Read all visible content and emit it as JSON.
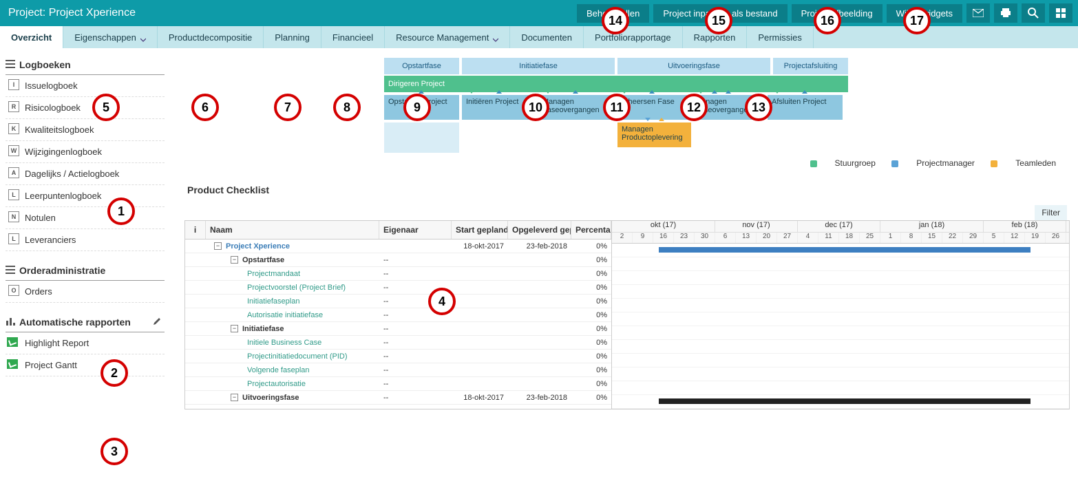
{
  "header": {
    "title": "Project: Project Xperience",
    "buttons": {
      "b14": "Beheer rollen",
      "b15": "Project inpakken als bestand",
      "b16": "Project afbeelding",
      "b17": "Wijzig widgets"
    }
  },
  "tabs": {
    "t0": "Overzicht",
    "t5": "Eigenschappen",
    "t6": "Productdecompositie",
    "t7": "Planning",
    "t8": "Financieel",
    "t9": "Resource Management",
    "t10": "Documenten",
    "t11": "Portfoliorapportage",
    "t12": "Rapporten",
    "t13": "Permissies"
  },
  "sidebar": {
    "sec1": "Logboeken",
    "items1": {
      "a": "Issuelogboek",
      "b": "Risicologboek",
      "c": "Kwaliteitslogboek",
      "d": "Wijzigingenlogboek",
      "e": "Dagelijks / Actielogboek",
      "f": "Leerpuntenlogboek",
      "g": "Notulen",
      "h": "Leveranciers"
    },
    "letters1": {
      "a": "I",
      "b": "R",
      "c": "K",
      "d": "W",
      "e": "A",
      "f": "L",
      "g": "N",
      "h": "L"
    },
    "sec2": "Orderadministratie",
    "items2": {
      "a": "Orders"
    },
    "letters2": {
      "a": "O"
    },
    "sec3": "Automatische rapporten",
    "items3": {
      "a": "Highlight Report",
      "b": "Project Gantt"
    }
  },
  "phase": {
    "headers": {
      "h1": "Opstartfase",
      "h2": "Initiatiefase",
      "h3": "Uitvoeringsfase",
      "h4": "Projectafsluiting"
    },
    "green": "Dirigeren Project",
    "row": {
      "b1": "Opstarten Project",
      "b2": "Initiëren Project",
      "b3": "Managen Faseovergangen",
      "b4": "Beheersen Fase",
      "b5": "Managen Faseovergangen",
      "b6": "Afsluiten Project",
      "b7": "Managen Productoplevering"
    },
    "legend": {
      "l1": "Stuurgroep",
      "l2": "Projectmanager",
      "l3": "Teamleden"
    }
  },
  "checklist": {
    "title": "Product Checklist",
    "filter": "Filter",
    "cols": {
      "i": "i",
      "naam": "Naam",
      "eig": "Eigenaar",
      "start": "Start gepland",
      "opg": "Opgeleverd gepland",
      "pct": "Percentage"
    },
    "rows": [
      {
        "indent": 0,
        "toggle": "−",
        "naam": "Project Xperience",
        "cls": "link-blue bold",
        "eig": "",
        "start": "18-okt-2017",
        "opg": "23-feb-2018",
        "pct": "0%"
      },
      {
        "indent": 1,
        "toggle": "−",
        "naam": "Opstartfase",
        "cls": "bold",
        "eig": "--",
        "start": "",
        "opg": "",
        "pct": "0%"
      },
      {
        "indent": 2,
        "toggle": "",
        "naam": "Projectmandaat",
        "cls": "link-teal",
        "eig": "--",
        "start": "",
        "opg": "",
        "pct": "0%"
      },
      {
        "indent": 2,
        "toggle": "",
        "naam": "Projectvoorstel (Project Brief)",
        "cls": "link-teal",
        "eig": "--",
        "start": "",
        "opg": "",
        "pct": "0%"
      },
      {
        "indent": 2,
        "toggle": "",
        "naam": "Initiatiefaseplan",
        "cls": "link-teal",
        "eig": "--",
        "start": "",
        "opg": "",
        "pct": "0%"
      },
      {
        "indent": 2,
        "toggle": "",
        "naam": "Autorisatie initiatiefase",
        "cls": "link-teal",
        "eig": "--",
        "start": "",
        "opg": "",
        "pct": "0%"
      },
      {
        "indent": 1,
        "toggle": "−",
        "naam": "Initiatiefase",
        "cls": "bold",
        "eig": "--",
        "start": "",
        "opg": "",
        "pct": "0%"
      },
      {
        "indent": 2,
        "toggle": "",
        "naam": "Initiele Business Case",
        "cls": "link-teal",
        "eig": "--",
        "start": "",
        "opg": "",
        "pct": "0%"
      },
      {
        "indent": 2,
        "toggle": "",
        "naam": "Projectinitiatiedocument (PID)",
        "cls": "link-teal",
        "eig": "--",
        "start": "",
        "opg": "",
        "pct": "0%"
      },
      {
        "indent": 2,
        "toggle": "",
        "naam": "Volgende faseplan",
        "cls": "link-teal",
        "eig": "--",
        "start": "",
        "opg": "",
        "pct": "0%"
      },
      {
        "indent": 2,
        "toggle": "",
        "naam": "Projectautorisatie",
        "cls": "link-teal",
        "eig": "--",
        "start": "",
        "opg": "",
        "pct": "0%"
      },
      {
        "indent": 1,
        "toggle": "−",
        "naam": "Uitvoeringsfase",
        "cls": "bold",
        "eig": "--",
        "start": "18-okt-2017",
        "opg": "23-feb-2018",
        "pct": "0%"
      }
    ],
    "gantt": {
      "months": [
        {
          "label": "okt (17)"
        },
        {
          "label": "nov (17)"
        },
        {
          "label": "dec (17)"
        },
        {
          "label": "jan (18)"
        },
        {
          "label": "feb (18)"
        }
      ],
      "days": [
        "2",
        "9",
        "16",
        "23",
        "30",
        "6",
        "13",
        "20",
        "27",
        "4",
        "11",
        "18",
        "25",
        "1",
        "8",
        "15",
        "22",
        "29",
        "5",
        "12",
        "19",
        "26"
      ]
    }
  },
  "markers": {
    "m1": "1",
    "m2": "2",
    "m3": "3",
    "m4": "4",
    "m5": "5",
    "m6": "6",
    "m7": "7",
    "m8": "8",
    "m9": "9",
    "m10": "10",
    "m11": "11",
    "m12": "12",
    "m13": "13",
    "m14": "14",
    "m15": "15",
    "m16": "16",
    "m17": "17"
  }
}
